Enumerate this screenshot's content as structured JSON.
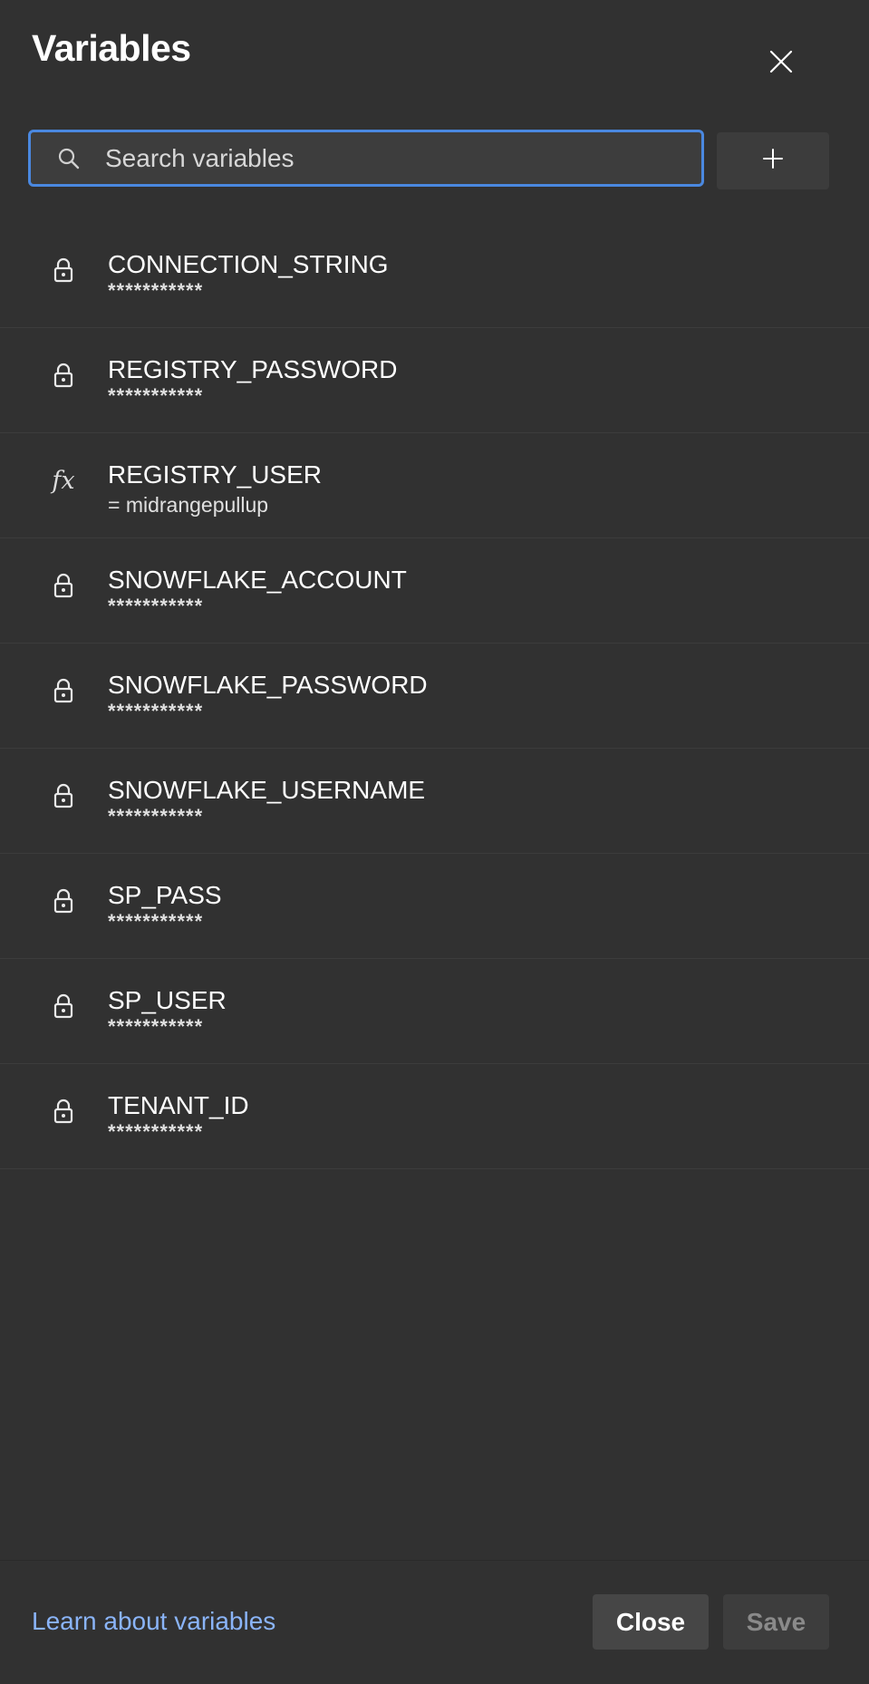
{
  "panel": {
    "title": "Variables",
    "close_icon": "close-icon"
  },
  "search": {
    "placeholder": "Search variables",
    "value": "",
    "icon": "search-icon"
  },
  "add_button": {
    "icon": "plus-icon"
  },
  "variables": [
    {
      "name": "CONNECTION_STRING",
      "value": "***********",
      "secret": true,
      "icon": "lock-icon"
    },
    {
      "name": "REGISTRY_PASSWORD",
      "value": "***********",
      "secret": true,
      "icon": "lock-icon"
    },
    {
      "name": "REGISTRY_USER",
      "value": "= midrangepullup",
      "secret": false,
      "icon": "fx-icon"
    },
    {
      "name": "SNOWFLAKE_ACCOUNT",
      "value": "***********",
      "secret": true,
      "icon": "lock-icon"
    },
    {
      "name": "SNOWFLAKE_PASSWORD",
      "value": "***********",
      "secret": true,
      "icon": "lock-icon"
    },
    {
      "name": "SNOWFLAKE_USERNAME",
      "value": "***********",
      "secret": true,
      "icon": "lock-icon"
    },
    {
      "name": "SP_PASS",
      "value": "***********",
      "secret": true,
      "icon": "lock-icon"
    },
    {
      "name": "SP_USER",
      "value": "***********",
      "secret": true,
      "icon": "lock-icon"
    },
    {
      "name": "TENANT_ID",
      "value": "***********",
      "secret": true,
      "icon": "lock-icon"
    }
  ],
  "footer": {
    "learn_link": "Learn about variables",
    "close_label": "Close",
    "save_label": "Save"
  },
  "colors": {
    "panel_background": "#313131",
    "focus_border": "#4a88e0",
    "link": "#8ab4f8",
    "disabled_text": "#8a8a8a"
  }
}
